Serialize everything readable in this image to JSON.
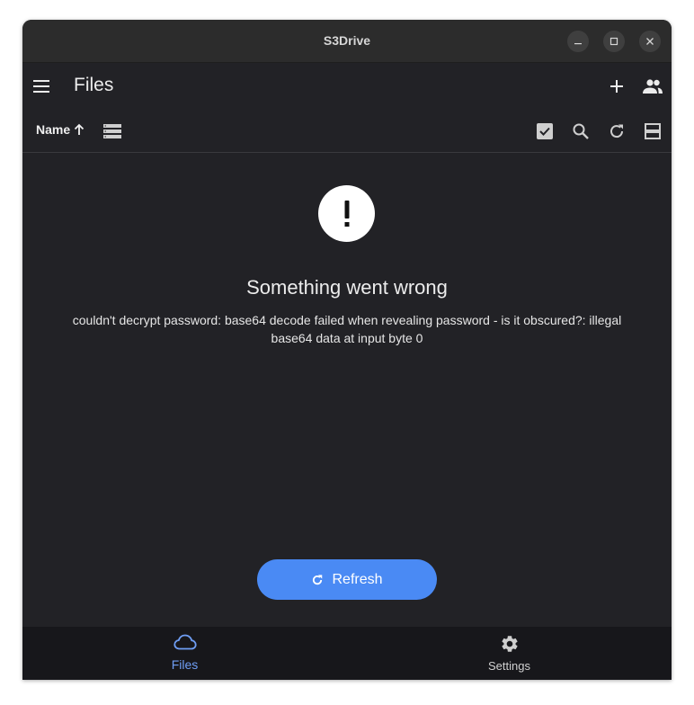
{
  "window": {
    "title": "S3Drive",
    "controls": [
      "minimize-icon",
      "maximize-icon",
      "close-icon"
    ]
  },
  "appbar": {
    "menu_icon": "hamburger-menu-icon",
    "title": "Files",
    "actions": [
      "add-icon",
      "people-icon"
    ]
  },
  "toolbar": {
    "sort_label": "Name",
    "sort_direction_icon": "arrow-up-icon",
    "view_icon": "list-view-icon",
    "actions": [
      "select-checkbox-icon",
      "search-icon",
      "refresh-icon",
      "layout-toggle-icon"
    ]
  },
  "error": {
    "icon": "exclamation-icon",
    "title": "Something went wrong",
    "message": "couldn't decrypt password: base64 decode failed when revealing password - is it obscured?: illegal base64 data at input byte 0",
    "button_label": "Refresh",
    "button_icon": "refresh-icon"
  },
  "bottom_nav": {
    "items": [
      {
        "label": "Files",
        "icon": "cloud-icon",
        "active": true
      },
      {
        "label": "Settings",
        "icon": "gear-icon",
        "active": false
      }
    ]
  },
  "colors": {
    "background": "#222226",
    "accent": "#4a8af4",
    "nav_active": "#6f9ef5",
    "nav_inactive": "#d0d0d0",
    "bottom_nav_bg": "#17171b"
  }
}
